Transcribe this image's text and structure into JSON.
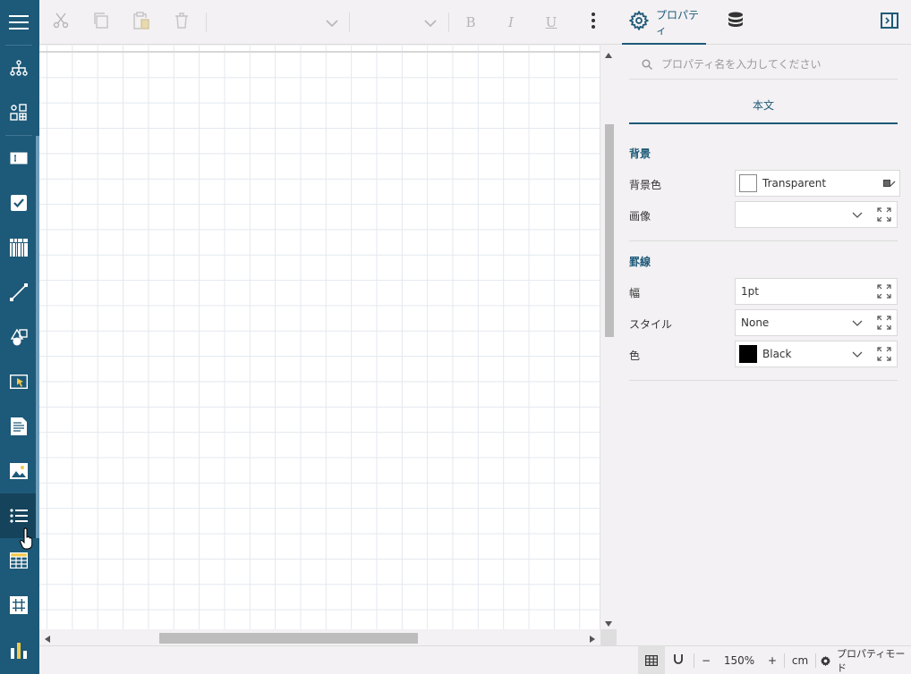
{
  "toolbar": {
    "cut_icon": "scissors-icon",
    "copy_icon": "copy-icon",
    "paste_icon": "paste-icon",
    "delete_icon": "trash-icon",
    "bold": "B",
    "italic": "I",
    "underline": "U",
    "more_icon": "more-vertical-icon"
  },
  "panel": {
    "tabs": [
      {
        "label": "プロパティ",
        "icon": "gear-icon",
        "active": true
      },
      {
        "label": "",
        "icon": "database-icon",
        "active": false
      }
    ],
    "collapse_icon": "panel-collapse-icon",
    "search": {
      "placeholder": "プロパティ名を入力してください"
    },
    "section_tab": "本文",
    "groups": {
      "background": {
        "title": "背景",
        "bg_color_label": "背景色",
        "bg_color_value": "Transparent",
        "image_label": "画像",
        "image_value": ""
      },
      "border": {
        "title": "罫線",
        "width_label": "幅",
        "width_value": "1pt",
        "style_label": "スタイル",
        "style_value": "None",
        "color_label": "色",
        "color_value": "Black"
      }
    }
  },
  "statusbar": {
    "zoom_minus": "−",
    "zoom": "150%",
    "zoom_plus": "+",
    "unit": "cm",
    "mode": "プロパティモード"
  },
  "sidebar": {
    "items": [
      "menu-icon",
      "tree-icon",
      "components-icon",
      "textbox-icon",
      "checkbox-icon",
      "barcode-icon",
      "line-icon",
      "shapes-icon",
      "select-icon",
      "richtext-icon",
      "image-icon",
      "list-icon",
      "table-icon",
      "grid-icon",
      "chart-icon"
    ]
  },
  "colors": {
    "accent": "#1d5978",
    "sidebar_bg": "#1d5978",
    "panel_bg": "#f3f1f3"
  }
}
